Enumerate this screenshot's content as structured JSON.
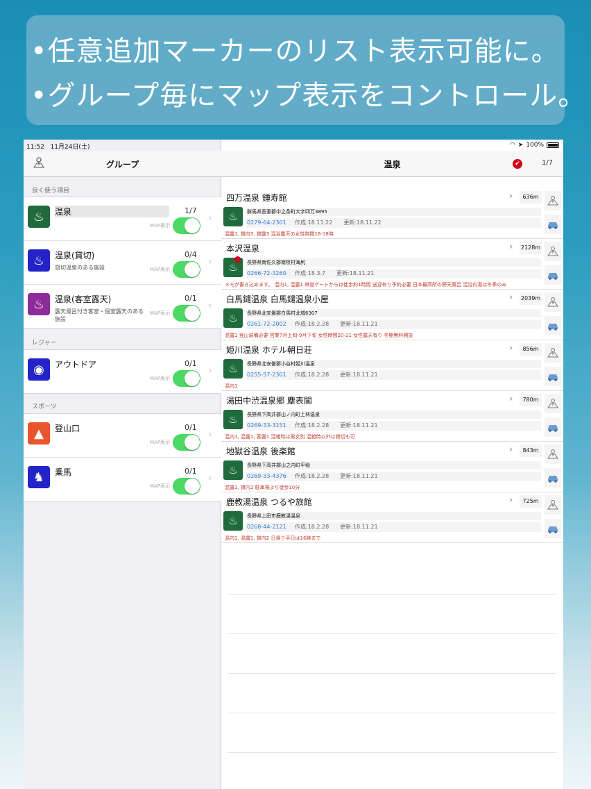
{
  "banner": {
    "line1": "•任意追加マーカーのリスト表示可能に。",
    "line2": "•グループ毎にマップ表示をコントロール。"
  },
  "status": {
    "time": "11:52",
    "date": "11月24日(土)",
    "battery": "100%"
  },
  "left": {
    "title": "グループ",
    "sections": [
      {
        "header": "良く使う項目",
        "rows": [
          {
            "name": "温泉",
            "sub": "",
            "count": "1/7",
            "map_label": "MAP表示",
            "color": "#1f6b3b",
            "icon": "onsen-icon",
            "glyph": "♨"
          },
          {
            "name": "温泉(貸切)",
            "sub": "貸切温泉のある施設",
            "count": "0/4",
            "map_label": "MAP表示",
            "color": "#2323c8",
            "icon": "onsen-icon",
            "glyph": "♨"
          },
          {
            "name": "温泉(客室露天)",
            "sub": "露天風呂付き客室・個室露天のある施設",
            "count": "0/1",
            "map_label": "MAP表示",
            "color": "#8e2a9a",
            "icon": "onsen-icon",
            "glyph": "♨"
          }
        ]
      },
      {
        "header": "レジャー",
        "rows": [
          {
            "name": "アウトドア",
            "sub": "",
            "count": "0/1",
            "map_label": "MAP表示",
            "color": "#2323c8",
            "icon": "bbq-icon",
            "glyph": "◉"
          }
        ]
      },
      {
        "header": "スポーツ",
        "rows": [
          {
            "name": "登山口",
            "sub": "",
            "count": "0/1",
            "map_label": "MAP表示",
            "color": "#e8542b",
            "icon": "hiking-icon",
            "glyph": "▲"
          },
          {
            "name": "乗馬",
            "sub": "",
            "count": "0/1",
            "map_label": "MAP表示",
            "color": "#2323c8",
            "icon": "horse-icon",
            "glyph": "♞"
          }
        ]
      }
    ]
  },
  "right": {
    "title": "温泉",
    "count": "1/7",
    "check": "✔",
    "spots": [
      {
        "name": "四万温泉 鍾寿館",
        "dist": "636m",
        "addr": "群馬県吾妻郡中之条町大字四万3895",
        "tel": "0279-64-2301",
        "created": "作成:18.11.22",
        "updated": "更新:18.11.22",
        "memo": "混露1, 貸内3, 貸露3 混浴露天の女性時間16-18時",
        "flag": false
      },
      {
        "name": "本沢温泉",
        "dist": "2128m",
        "addr": "長野県南佐久郡南牧村海尻",
        "tel": "0266-72-3260",
        "created": "作成:18.3.7",
        "updated": "更新:18.11.21",
        "memo": "メモが書き込めます。 混内1, 混露1 林道ゲートからは徒歩約1時間 送迎有り予約必要 日本最高所の野天風呂 混浴内湯は冬季のみ",
        "flag": true
      },
      {
        "name": "白馬鑓温泉 白馬鑓温泉小屋",
        "dist": "2039m",
        "addr": "長野県北安曇郡白馬村北城6307",
        "tel": "0261-72-2002",
        "created": "作成:18.2.28",
        "updated": "更新:18.11.21",
        "memo": "混露1 登山装備必要 営業7月上旬-9月下旬 女性時間20-21 女性露天有り 冬期無料開放",
        "flag": false
      },
      {
        "name": "姫川温泉 ホテル朝日荘",
        "dist": "856m",
        "addr": "長野県北安曇郡小谷村姫川温泉",
        "tel": "0255-57-2301",
        "created": "作成:18.2.28",
        "updated": "更新:18.11.21",
        "memo": "混内1",
        "flag": false
      },
      {
        "name": "湯田中渋温泉郷 塵表閣",
        "dist": "780m",
        "addr": "長野県下高井郡山ノ内町上林温泉",
        "tel": "0269-33-3151",
        "created": "作成:18.2.28",
        "updated": "更新:18.11.21",
        "memo": "混内1, 混露1, 客露1 混雑時は男女別 混雑時以外は貸切も可",
        "flag": false
      },
      {
        "name": "地獄谷温泉 後楽館",
        "dist": "843m",
        "addr": "長野県下高井郡山之内町平穏",
        "tel": "0269-33-4376",
        "created": "作成:18.2.28",
        "updated": "更新:18.11.21",
        "memo": "混露1, 貸内2 駐車場より徒歩10分",
        "flag": false
      },
      {
        "name": "鹿教湯温泉 つるや旅館",
        "dist": "725m",
        "addr": "長野県上田市鹿教湯温泉",
        "tel": "0268-44-2121",
        "created": "作成:18.2.28",
        "updated": "更新:18.11.21",
        "memo": "混内1, 混露1, 貸内2 日帰り平日は16時まで",
        "flag": false
      }
    ]
  }
}
